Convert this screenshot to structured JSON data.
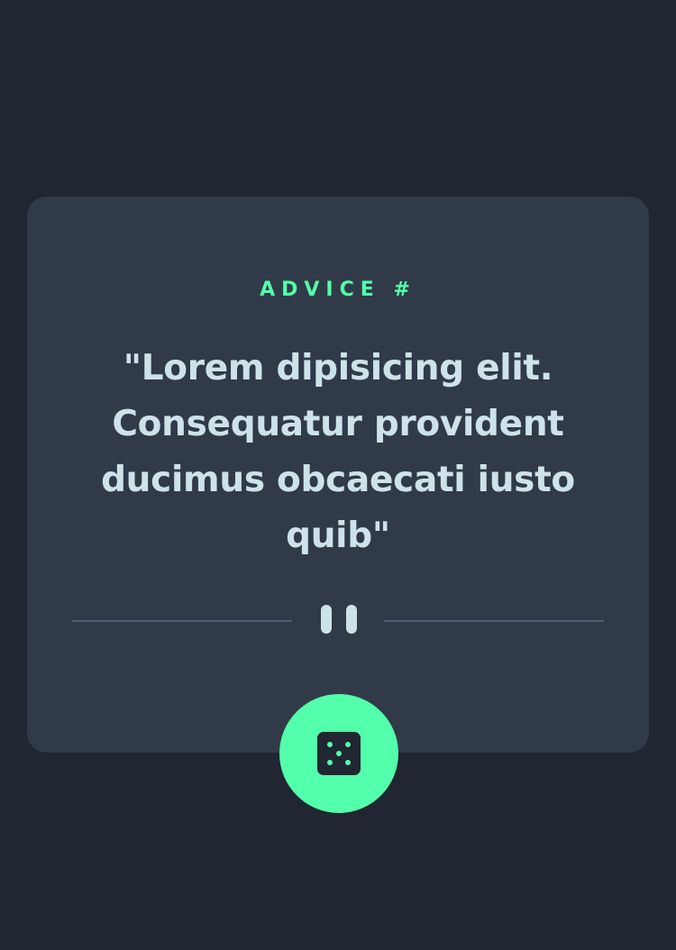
{
  "advice": {
    "label": "ADVICE #",
    "quote": "\"Lorem dipisicing elit. Consequatur provident ducimus obcaecati iusto quib\""
  },
  "icons": {
    "divider": "pause-divider-icon",
    "dice": "dice-icon"
  },
  "colors": {
    "background": "#202632",
    "card": "#313a48",
    "accent": "#53ffaa",
    "text": "#cee3e9",
    "divider": "#4f5d74"
  }
}
